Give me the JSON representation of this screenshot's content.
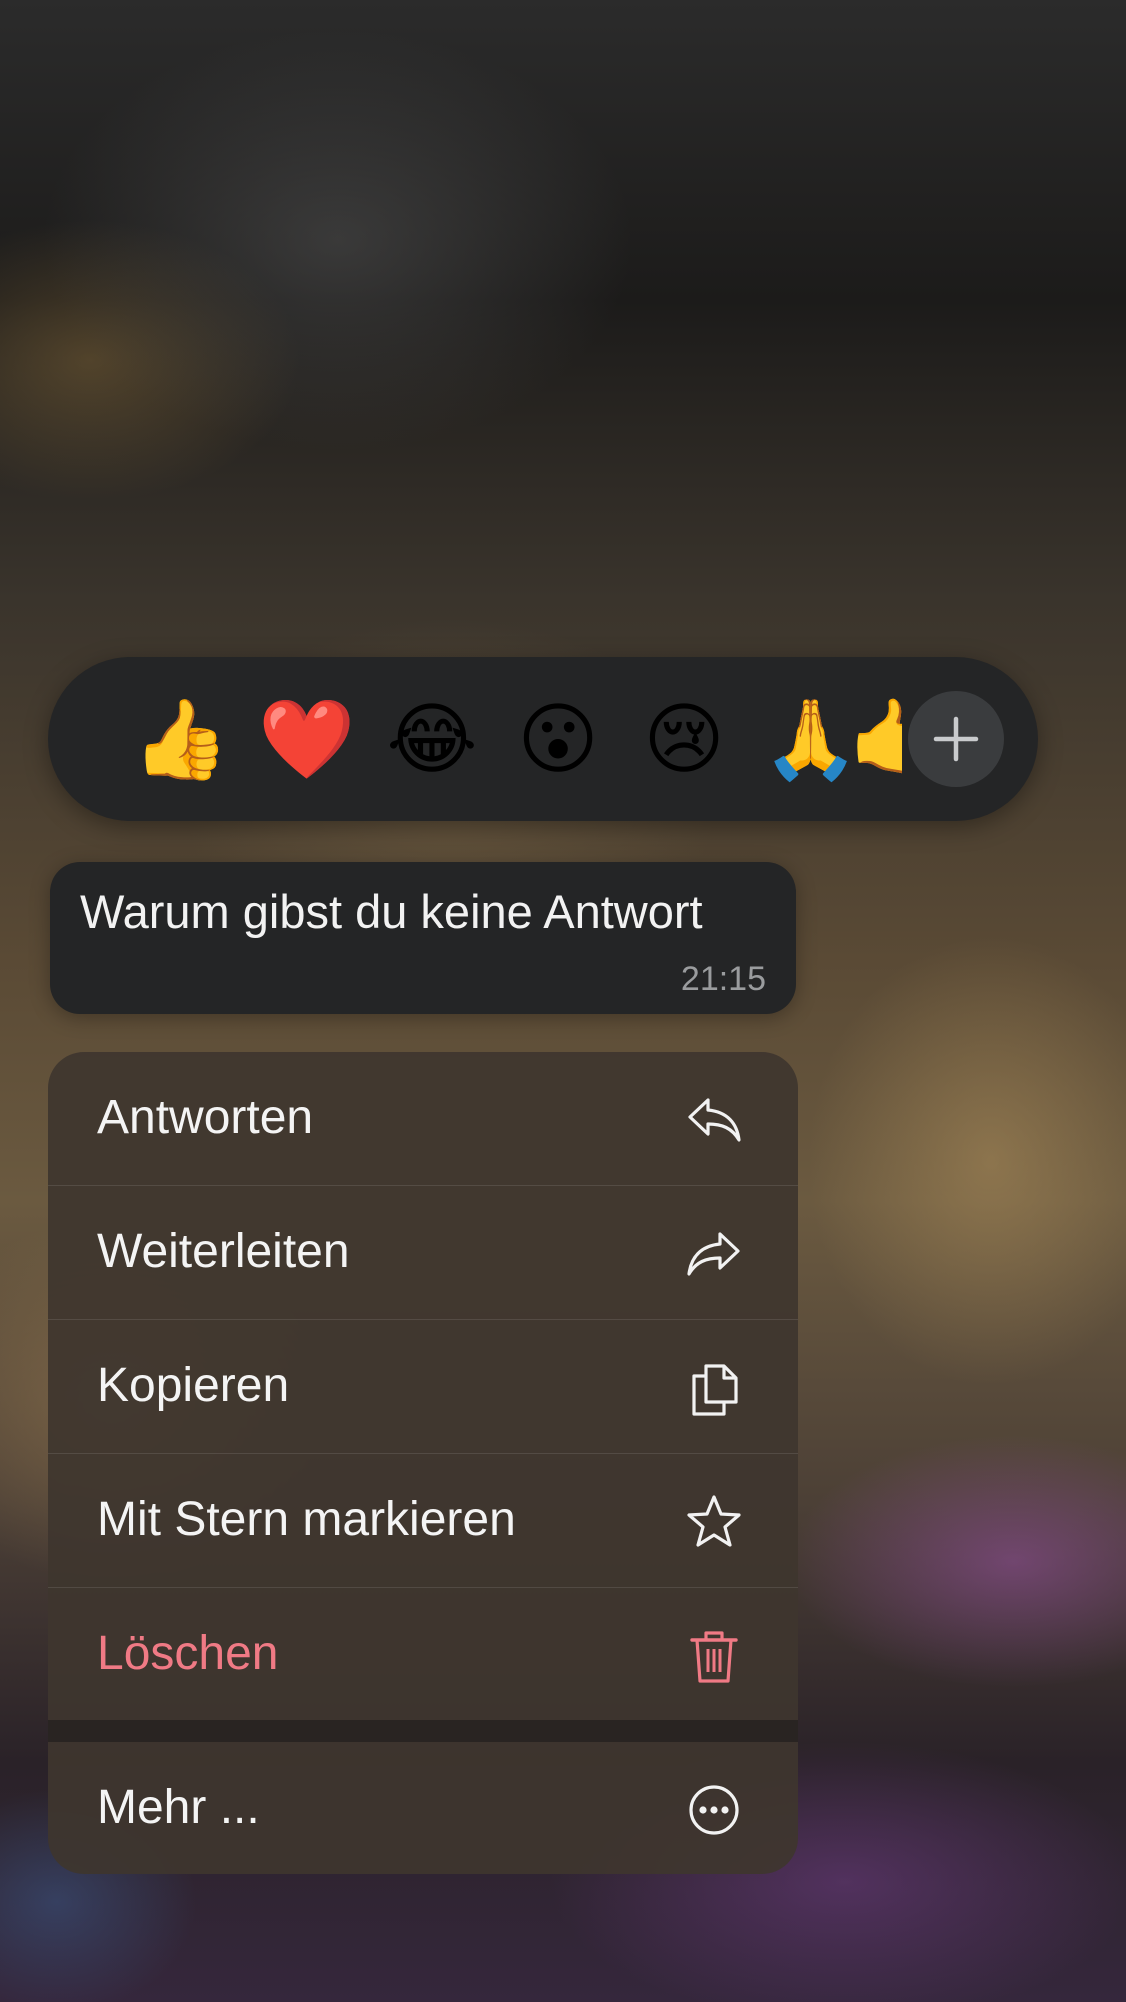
{
  "reactions": {
    "emojis": [
      {
        "name": "thumbs-up",
        "char": "👍"
      },
      {
        "name": "red-heart",
        "char": "❤️"
      },
      {
        "name": "tears-of-joy",
        "char": "😂"
      },
      {
        "name": "surprised",
        "char": "😮"
      },
      {
        "name": "crying",
        "char": "😢"
      },
      {
        "name": "folded-hands",
        "char": "🙏"
      },
      {
        "name": "partial-emoji",
        "char": "🤙"
      }
    ],
    "add_icon": "plus-icon"
  },
  "message": {
    "text": "Warum gibst du keine Antwort",
    "time": "21:15"
  },
  "menu": {
    "items": [
      {
        "label": "Antworten",
        "icon": "reply-icon"
      },
      {
        "label": "Weiterleiten",
        "icon": "forward-icon"
      },
      {
        "label": "Kopieren",
        "icon": "copy-icon"
      },
      {
        "label": "Mit Stern markieren",
        "icon": "star-icon"
      },
      {
        "label": "Löschen",
        "icon": "trash-icon",
        "color": "#f07a85"
      }
    ],
    "more": {
      "label": "Mehr ...",
      "icon": "more-icon"
    }
  }
}
